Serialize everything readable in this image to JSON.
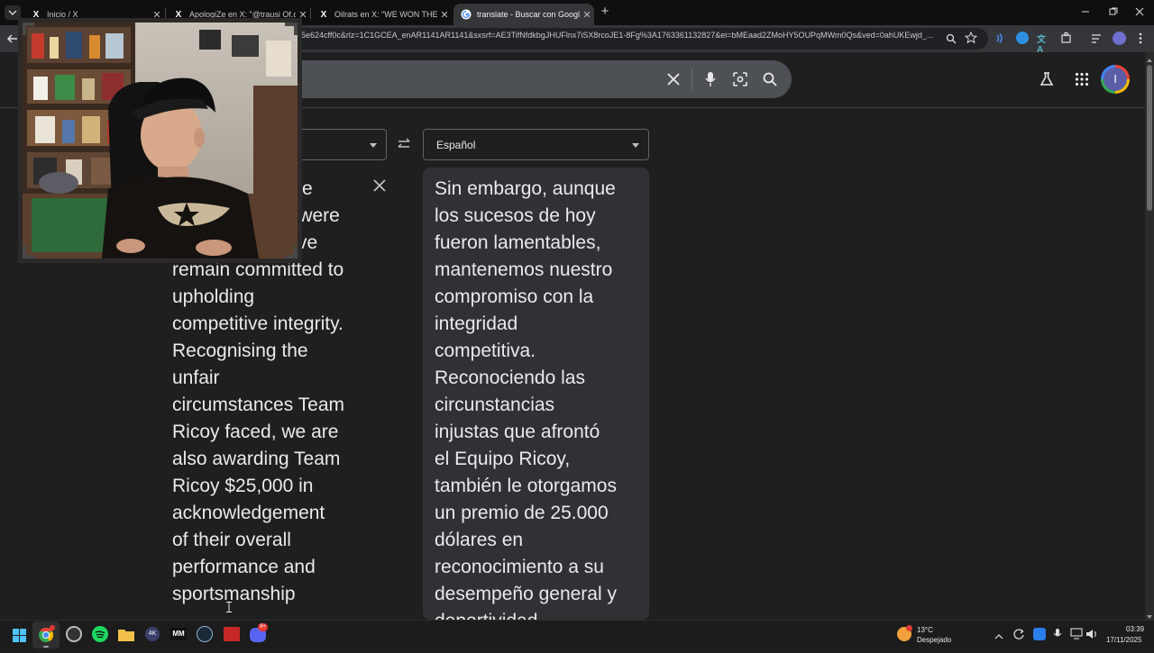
{
  "browser": {
    "tabs": [
      {
        "title": "Inicio / X",
        "icon": "x-logo-icon",
        "active": false
      },
      {
        "title": "ApologiZe en X: \"@trausi Of.cu",
        "icon": "x-logo-icon",
        "active": false
      },
      {
        "title": "Oilrats en X: \"WE WON THE FIR",
        "icon": "x-logo-icon",
        "active": false
      },
      {
        "title": "translate - Buscar con Google",
        "icon": "google-g-icon",
        "active": true
      }
    ],
    "new_tab_label": "+",
    "url": "5e624cff0c&rlz=1C1GCEA_enAR1141AR1141&sxsrf=AE3TifNfdkbgJHUFlnx7iSX8rcoJE1-8Fg%3A1763361132827&ei=bMEaad2ZMoHY5OUPqMWm0Qs&ved=0ahUKEwjd_..."
  },
  "translate": {
    "source_lang_selected": "",
    "target_lang": "Español",
    "source_lines": [
      "e",
      "s were",
      "ve",
      "remain committed to",
      "upholding",
      "competitive integrity.",
      "Recognising the",
      "unfair",
      "circumstances Team",
      "Ricoy faced, we are",
      "also awarding Team",
      "Ricoy $25,000 in",
      "acknowledgement",
      "of their overall",
      "performance and",
      "sportsmanship"
    ],
    "target_lines": [
      "Sin embargo, aunque",
      "los sucesos de hoy",
      "fueron lamentables,",
      "mantenemos nuestro",
      "compromiso con la",
      "integridad",
      "competitiva.",
      "Reconociendo las",
      "circunstancias",
      "injustas que afrontó",
      "el Equipo Ricoy,",
      "también le otorgamos",
      "un premio de 25.000",
      "dólares en",
      "reconocimiento a su",
      "desempeño general y",
      "deportividad"
    ]
  },
  "taskbar": {
    "weather_temp": "13°C",
    "weather_desc": "Despejado",
    "time": "03:39",
    "date": "17/11/2025",
    "discord_badge": "9+"
  },
  "colors": {
    "page_bg": "#1f1f1f",
    "panel_bg": "#303134",
    "accent_blue": "#8ab4f8",
    "avatar": "#5b5ea6"
  }
}
